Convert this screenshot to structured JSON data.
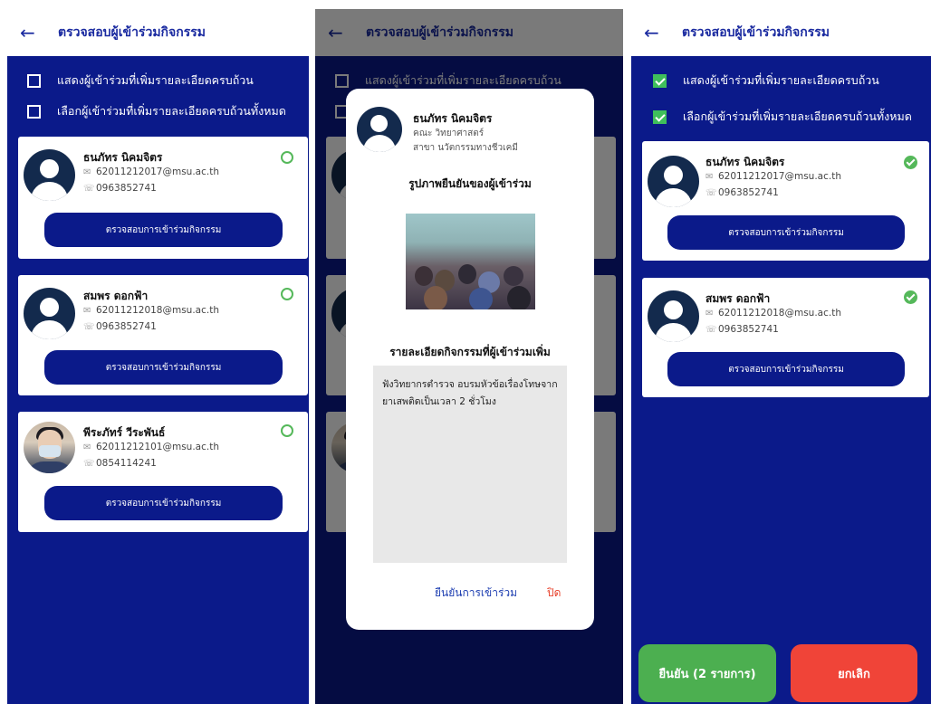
{
  "screen_title": "ตรวจสอบผู้เข้าร่วมกิจกรรม",
  "options": {
    "show_details": "แสดงผู้เข้าร่วมที่เพิ่มรายละเอียดครบถ้วน",
    "select_all": "เลือกผู้เข้าร่วมที่เพิ่มรายละเอียดครบถ้วนทั้งหมด"
  },
  "participants": [
    {
      "name": "ธนภัทร นิคมจิตร",
      "email": "62011212017@msu.ac.th",
      "phone": "0963852741"
    },
    {
      "name": "สมพร ดอกฟ้า",
      "email": "62011212018@msu.ac.th",
      "phone": "0963852741"
    },
    {
      "name": "พีระภัทร์ วีระพันธ์",
      "email": "62011212101@msu.ac.th",
      "phone": "0854114241"
    }
  ],
  "verify_button": "ตรวจสอบการเข้าร่วมกิจกรรม",
  "modal": {
    "name": "ธนภัทร นิคมจิตร",
    "faculty": "คณะ วิทยาศาสตร์",
    "major": "สาขา นวัตกรรมทางชีวเคมี",
    "photo_title": "รูปภาพยืนยันของผู้เข้าร่วม",
    "detail_title": "รายละเอียดกิจกรรมที่ผู้เข้าร่วมเพิ่ม",
    "detail_text": "ฟังวิทยากรตำรวจ อบรมหัวข้อเรื่องโทษจากยาเสพติดเป็นเวลา 2 ชั่วโมง",
    "confirm": "ยืนยันการเข้าร่วม",
    "close": "ปิด"
  },
  "actions": {
    "confirm": "ยืนยัน (2 รายการ)",
    "cancel": "ยกเลิก"
  },
  "colors": {
    "primary": "#0b1a8a",
    "success": "#55b85a",
    "cancel": "#f04438",
    "close": "#e8442e"
  }
}
